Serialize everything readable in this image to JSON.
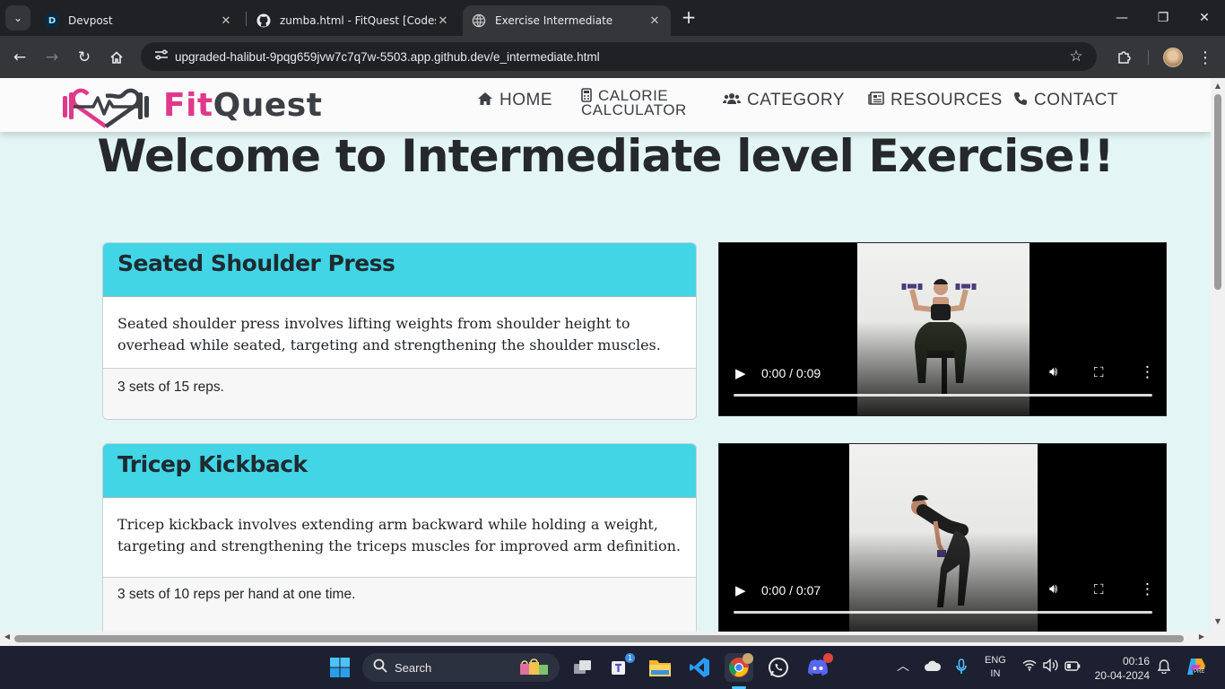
{
  "browser": {
    "tabs": [
      {
        "title": "Devpost",
        "favicon": "D"
      },
      {
        "title": "zumba.html - FitQuest [Codesp",
        "favicon": "github-icon"
      },
      {
        "title": "Exercise Intermediate",
        "favicon": "globe-icon"
      }
    ],
    "active_tab": 2,
    "url": "upgraded-halibut-9pqg659jvw7c7q7w-5503.app.github.dev/e_intermediate.html"
  },
  "site": {
    "brand_fit": "Fit",
    "brand_quest": "Quest",
    "brand_color": "#e0388a",
    "nav": [
      {
        "label": "HOME",
        "icon": "home-icon"
      },
      {
        "label_line1": "CALORIE",
        "label_line2": "CALCULATOR",
        "icon": "calculator-icon"
      },
      {
        "label": "CATEGORY",
        "icon": "users-icon"
      },
      {
        "label": "RESOURCES",
        "icon": "newspaper-icon"
      },
      {
        "label": "CONTACT",
        "icon": "phone-icon"
      }
    ]
  },
  "page": {
    "heading": "Welcome to Intermediate level Exercise!!",
    "exercises": [
      {
        "title": "Seated Shoulder Press",
        "description": "Seated shoulder press involves lifting weights from shoulder height to overhead while seated, targeting and strengthening the shoulder muscles.",
        "sets": "3 sets of 15 reps.",
        "video_time": "0:00 / 0:09"
      },
      {
        "title": "Tricep Kickback",
        "description": "Tricep kickback involves extending arm backward while holding a weight, targeting and strengthening the triceps muscles for improved arm definition.",
        "sets": "3 sets of 10 reps per hand at one time.",
        "video_time": "0:00 / 0:07"
      }
    ],
    "header_color": "#41d5e6",
    "background_color": "#e3f6f5"
  },
  "taskbar": {
    "search_placeholder": "Search",
    "teams_badge": "1",
    "language_line1": "ENG",
    "language_line2": "IN",
    "time": "00:16",
    "date": "20-04-2024",
    "copilot_badge": "PRE"
  }
}
